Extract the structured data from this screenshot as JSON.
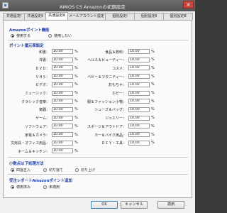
{
  "window": {
    "title": "AMIOS CS Amazonの初期設定"
  },
  "tabs": [
    {
      "label": "共通設定Ⅰ"
    },
    {
      "label": "共通設定Ⅱ"
    },
    {
      "label": "共通設定Ⅲ"
    },
    {
      "label": "メールアカウント設定"
    },
    {
      "label": "個別設定Ⅰ"
    },
    {
      "label": "個別設定Ⅱ"
    },
    {
      "label": "個別設定Ⅲ"
    }
  ],
  "active_tab": "共通設定Ⅲ",
  "amazon_points_usage": {
    "title": "Amazonポイント機能",
    "options": [
      {
        "label": "使用する",
        "selected": true
      },
      {
        "label": "使用しない",
        "selected": false
      }
    ]
  },
  "point_rates": {
    "title": "ポイント還元率設定",
    "unit": "%",
    "left": [
      {
        "label": "和書：",
        "value": "10.00"
      },
      {
        "label": "洋書：",
        "value": "10.00"
      },
      {
        "label": "ＤＶＤ：",
        "value": "10.00"
      },
      {
        "label": "ＶＨＳ：",
        "value": "10.00"
      },
      {
        "label": "ビデオ：",
        "value": "10.00"
      },
      {
        "label": "ミュージック：",
        "value": "10.00"
      },
      {
        "label": "クラシック音楽：",
        "value": "10.00"
      },
      {
        "label": "楽器：",
        "value": "10.00"
      },
      {
        "label": "ゲーム：",
        "value": "10.00"
      },
      {
        "label": "ソフトウェア：",
        "value": "10.00"
      },
      {
        "label": "家電＆カメラ：",
        "value": "10.00"
      },
      {
        "label": "文房具・オフィス用品：",
        "value": "10.00"
      },
      {
        "label": "ホーム＆キッチン：",
        "value": "10.00"
      }
    ],
    "right": [
      {
        "label": "食品＆飲料：",
        "value": "10.00"
      },
      {
        "label": "ヘルス＆ビューティー：",
        "value": "10.00"
      },
      {
        "label": "コスメ：",
        "value": "10.00"
      },
      {
        "label": "ベビー＆マタニティー：",
        "value": "10.00"
      },
      {
        "label": "おもちゃ：",
        "value": "10.00"
      },
      {
        "label": "ホビー：",
        "value": "10.00"
      },
      {
        "label": "服＆ファッション小物：",
        "value": "10.00"
      },
      {
        "label": "シューズ＆バッグ：",
        "value": "10.00"
      },
      {
        "label": "ジュエリー：",
        "value": "10.00"
      },
      {
        "label": "スポーツ＆アウトドア：",
        "value": "10.00"
      },
      {
        "label": "カー＆バイク用品：",
        "value": "10.00"
      },
      {
        "label": "ＤＩＹ・工具：",
        "value": "10.00"
      }
    ]
  },
  "decimal_handling": {
    "title": "小数点以下処理方法",
    "options": [
      {
        "label": "四捨五入",
        "selected": true
      },
      {
        "label": "切り捨て",
        "selected": false
      },
      {
        "label": "切り上げ",
        "selected": false
      }
    ]
  },
  "points_grant": {
    "title": "受注レポートAmazonポイント追加",
    "options": [
      {
        "label": "適用済み",
        "selected": true
      },
      {
        "label": "未適用",
        "selected": false
      }
    ]
  },
  "buttons": {
    "ok": "OK",
    "cancel": "キャンセル",
    "apply": "適用"
  }
}
